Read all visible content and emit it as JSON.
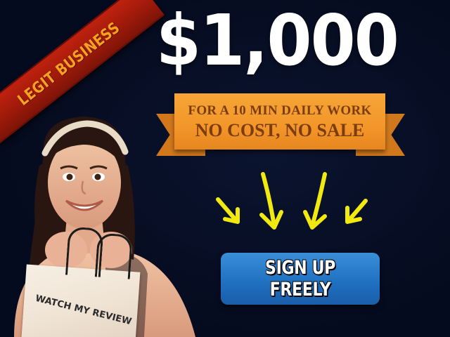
{
  "ribbon": {
    "text": "LEGIT BUSINESS",
    "color": "#b01c0c",
    "text_color": "#f4a21f"
  },
  "headline": {
    "amount": "$1,000"
  },
  "banner": {
    "line1": "FOR A 10 MIN DAILY WORK",
    "line2": "NO COST, NO SALE",
    "color": "#f39a2c",
    "text_color": "#7b3d0f"
  },
  "cta": {
    "label": "SIGN UP FREELY",
    "color": "#2378c9"
  },
  "bag": {
    "label": "WATCH MY REVIEW"
  },
  "colors": {
    "background": "#050b1e",
    "arrow": "#f2e90f"
  }
}
